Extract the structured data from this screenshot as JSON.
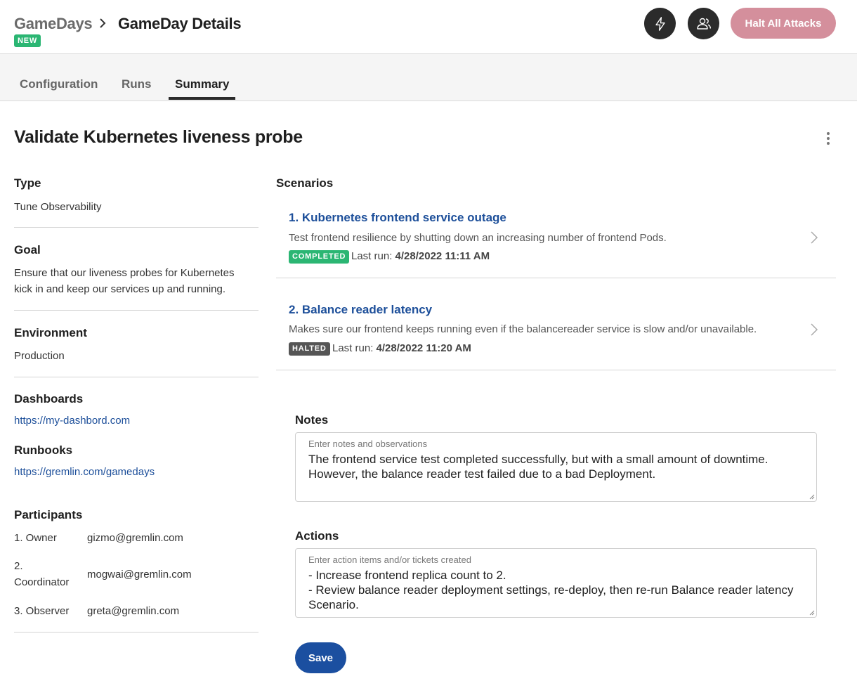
{
  "header": {
    "breadcrumb_root": "GameDays",
    "breadcrumb_current": "GameDay Details",
    "new_badge": "NEW",
    "halt_button": "Halt All Attacks",
    "attack_icon": "lightning-icon",
    "team_icon": "users-icon"
  },
  "tabs": [
    {
      "label": "Configuration",
      "active": false
    },
    {
      "label": "Runs",
      "active": false
    },
    {
      "label": "Summary",
      "active": true
    }
  ],
  "page": {
    "title": "Validate Kubernetes liveness probe",
    "menu_icon": "more-vertical-icon"
  },
  "details": {
    "type_label": "Type",
    "type_value": "Tune Observability",
    "goal_label": "Goal",
    "goal_value": "Ensure that our liveness probes for Kubernetes kick in and keep our services up and running.",
    "environment_label": "Environment",
    "environment_value": "Production",
    "dashboards_label": "Dashboards",
    "dashboards_link": "https://my-dashbord.com",
    "runbooks_label": "Runbooks",
    "runbooks_link": "https://gremlin.com/gamedays",
    "participants_label": "Participants",
    "participants": [
      {
        "role": "1. Owner",
        "email": "gizmo@gremlin.com"
      },
      {
        "role": "2. Coordinator",
        "email": "mogwai@gremlin.com"
      },
      {
        "role": "3. Observer",
        "email": "greta@gremlin.com"
      }
    ]
  },
  "scenarios": {
    "heading": "Scenarios",
    "last_run_label": "Last run:",
    "items": [
      {
        "title": "1. Kubernetes frontend service outage",
        "description": "Test frontend resilience by shutting down an increasing number of frontend Pods.",
        "status": "COMPLETED",
        "status_color": "#2bb673",
        "last_run": "4/28/2022 11:11 AM"
      },
      {
        "title": "2. Balance reader latency",
        "description": "Makes sure our frontend keeps running even if the balancereader service is slow and/or unavailable.",
        "status": "HALTED",
        "status_color": "#555555",
        "last_run": "4/28/2022 11:20 AM"
      }
    ]
  },
  "notes": {
    "label": "Notes",
    "placeholder": "Enter notes and observations",
    "value": "The frontend service test completed successfully, but with a small amount of downtime. However, the balance reader test failed due to a bad Deployment."
  },
  "actions": {
    "label": "Actions",
    "placeholder": "Enter action items and/or tickets created",
    "value": "- Increase frontend replica count to 2.\n- Review balance reader deployment settings, re-deploy, then re-run Balance reader latency Scenario."
  },
  "save_button": "Save"
}
